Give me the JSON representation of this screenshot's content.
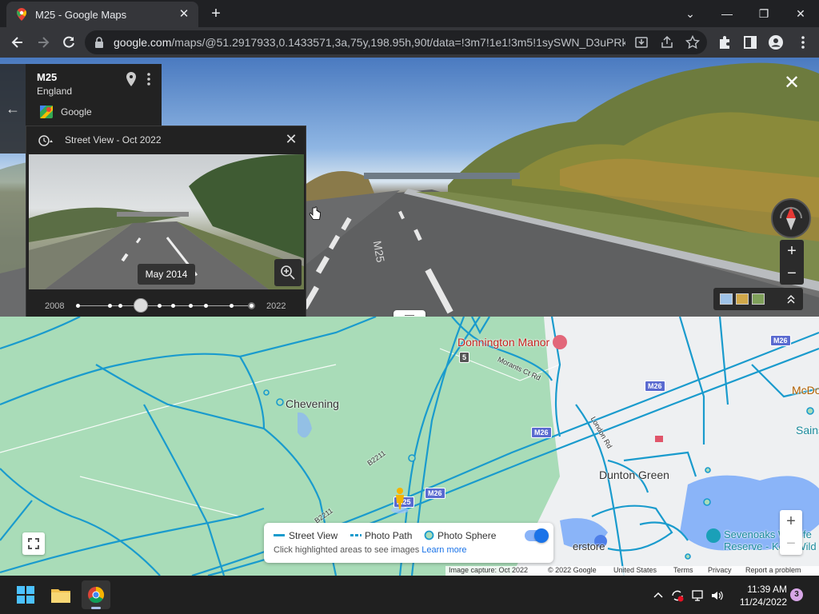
{
  "browser": {
    "tab_title": "M25 - Google Maps",
    "tab_close": "✕",
    "new_tab": "+",
    "url_host": "google.com",
    "url_rest": "/maps/@51.2917933,0.1433571,3a,75y,198.95h,90t/data=!3m7!1e1!3m5!1sySWN_D3uPRk...",
    "window_controls": [
      "⌄",
      "—",
      "❐",
      "✕"
    ]
  },
  "street_view": {
    "close": "✕",
    "road_marking": "M25",
    "location": {
      "name": "M25",
      "region": "England",
      "source": "Google",
      "back": "←"
    },
    "time_machine": {
      "title": "Street View - Oct 2022",
      "close": "✕",
      "selected_date": "May 2014",
      "year_start": "2008",
      "year_end": "2022",
      "selected_fraction": 0.36
    },
    "zoom_in": "+",
    "zoom_out": "−"
  },
  "map": {
    "places": {
      "donnington": "Donnington Manor",
      "chevening": "Chevening",
      "dunton_green": "Dunton Green",
      "sevenoaks": "Sevenoaks Wildlife Reserve - Kent Wild",
      "mcdo": "McDo",
      "sains": "Sains",
      "erstore": "erstore"
    },
    "roads": {
      "m26_a": "M26",
      "m26_b": "M26",
      "m26_c": "M26",
      "m26_d": "M26",
      "m25": "M25",
      "five": "5",
      "morants": "Morants Ct Rd",
      "london_rd": "London Rd",
      "b2211_a": "B2211",
      "b2211_b": "B2211"
    },
    "legend": {
      "street_view": "Street View",
      "photo_path": "Photo Path",
      "photo_sphere": "Photo Sphere",
      "hint": "Click highlighted areas to see images",
      "learn_more": "Learn more"
    },
    "zoom_in": "+",
    "zoom_out": "−",
    "attribution": {
      "capture": "Image capture: Oct 2022",
      "copyright": "© 2022 Google",
      "country": "United States",
      "terms": "Terms",
      "privacy": "Privacy",
      "report": "Report a problem"
    }
  },
  "taskbar": {
    "time": "11:39 AM",
    "date": "11/24/2022",
    "notifications": "3"
  }
}
